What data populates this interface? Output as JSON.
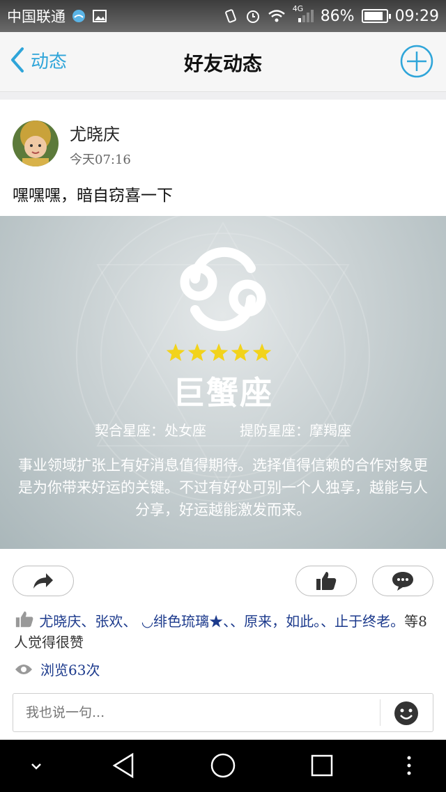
{
  "statusbar": {
    "carrier": "中国联通",
    "network": "4G",
    "battery_percent": "86%",
    "battery_level": 0.86,
    "time": "09:29"
  },
  "nav": {
    "back_label": "动态",
    "title": "好友动态"
  },
  "post": {
    "username": "尤晓庆",
    "time": "今天07:16",
    "text": "嘿嘿嘿，暗自窃喜一下",
    "image": {
      "rating_stars": 5,
      "sign_name": "巨蟹座",
      "match_label": "契合星座：处女座",
      "beware_label": "提防星座：摩羯座",
      "fortune": "事业领域扩张上有好消息值得期待。选择值得信赖的合作对象更是为你带来好运的关键。不过有好处可别一个人独享，越能与人分享，好运越能激发而来。"
    }
  },
  "actions": {
    "share_icon": "share-arrow-icon",
    "like_icon": "thumbs-up-icon",
    "comment_icon": "comment-bubble-icon"
  },
  "likes": {
    "names": "尤晓庆、张欢、 ◡绯色琉璃★、、原来，如此。、止于终老。",
    "suffix": "等8人觉得很赞"
  },
  "views": "浏览63次",
  "comment": {
    "placeholder": "我也说一句..."
  },
  "colors": {
    "accent": "#2fa5d9",
    "link": "#1c3a8c",
    "star": "#f2d31b"
  }
}
